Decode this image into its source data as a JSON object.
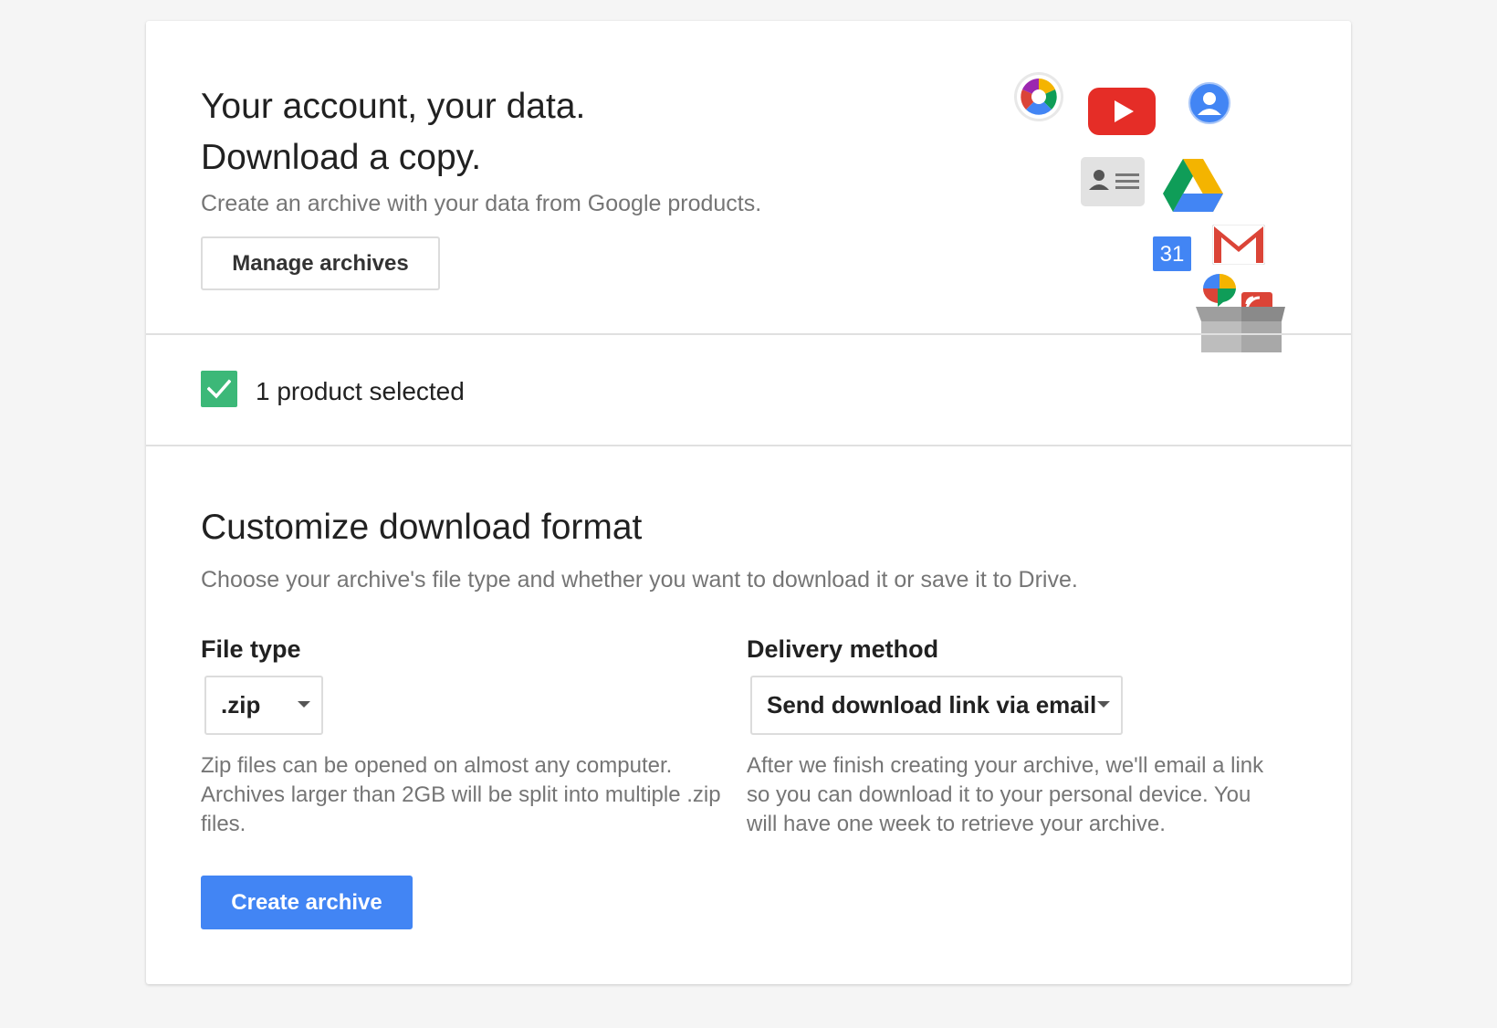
{
  "hero": {
    "title_line1": "Your account, your data.",
    "title_line2": "Download a copy.",
    "subtitle": "Create an archive with your data from Google products.",
    "manage_button": "Manage archives",
    "product_icons": [
      "picasa-icon",
      "youtube-icon",
      "profile-icon",
      "contacts-icon",
      "drive-icon",
      "calendar-icon",
      "gmail-icon",
      "hangouts-icon",
      "reader-icon",
      "box-icon"
    ],
    "calendar_day": "31"
  },
  "selection": {
    "checked": true,
    "label": "1 product selected"
  },
  "customize": {
    "title": "Customize download format",
    "subtitle": "Choose your archive's file type and whether you want to download it or save it to Drive.",
    "file_type": {
      "label": "File type",
      "value": ".zip",
      "help": "Zip files can be opened on almost any computer. Archives larger than 2GB will be split into multiple .zip files."
    },
    "delivery": {
      "label": "Delivery method",
      "value": "Send download link via email",
      "help": "After we finish creating your archive, we'll email a link so you can download it to your personal device. You will have one week to retrieve your archive."
    },
    "create_button": "Create archive"
  },
  "colors": {
    "primary": "#4285f4",
    "check": "#3cb878",
    "background": "#f5f5f5"
  }
}
